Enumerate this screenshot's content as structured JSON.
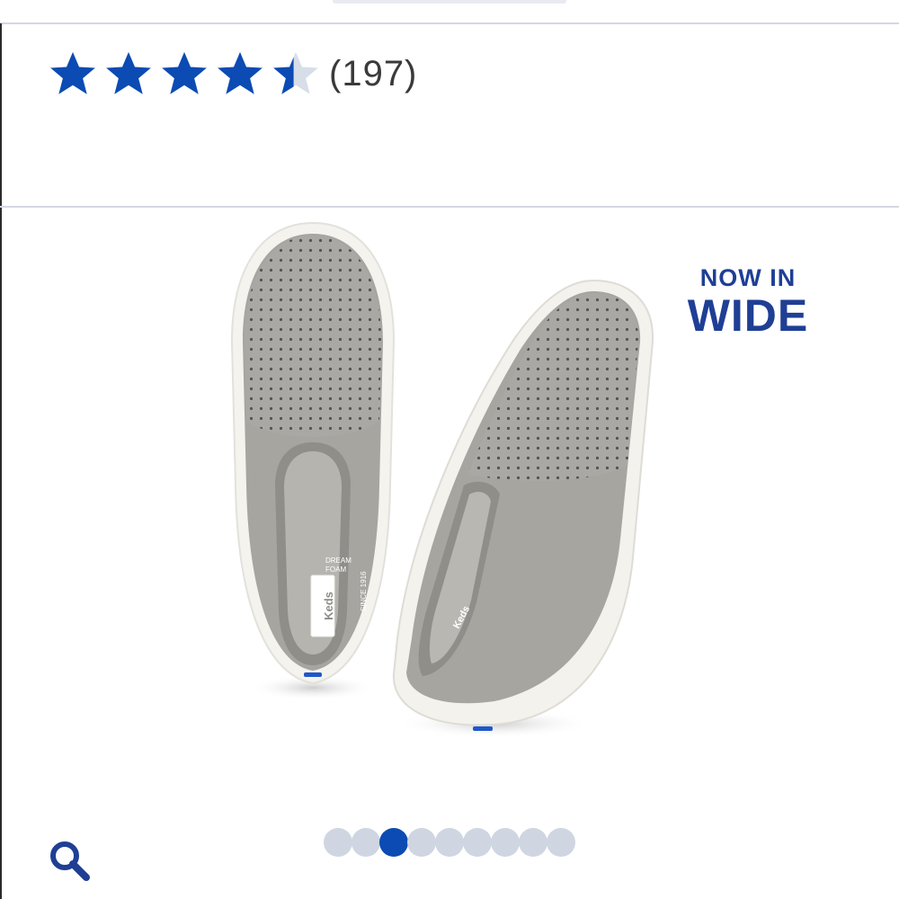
{
  "rating": {
    "value": 4.5,
    "max": 5,
    "count_label": "(197)",
    "star_color": "#0b4bb3",
    "empty_star_color": "#d7dee8"
  },
  "hero": {
    "badge_line1": "NOW IN",
    "badge_line2": "WIDE",
    "badge_color": "#1f3f95",
    "shoe_brand_label": "Keds",
    "shoe_tag_line1": "DREAM",
    "shoe_tag_line2": "FOAM",
    "shoe_tag_since": "SINCE 1916"
  },
  "carousel": {
    "total": 9,
    "active_index": 2,
    "active_color": "#0b4bb3",
    "inactive_color": "#cfd6e2"
  },
  "toolbar": {
    "search_icon": "search-icon"
  }
}
